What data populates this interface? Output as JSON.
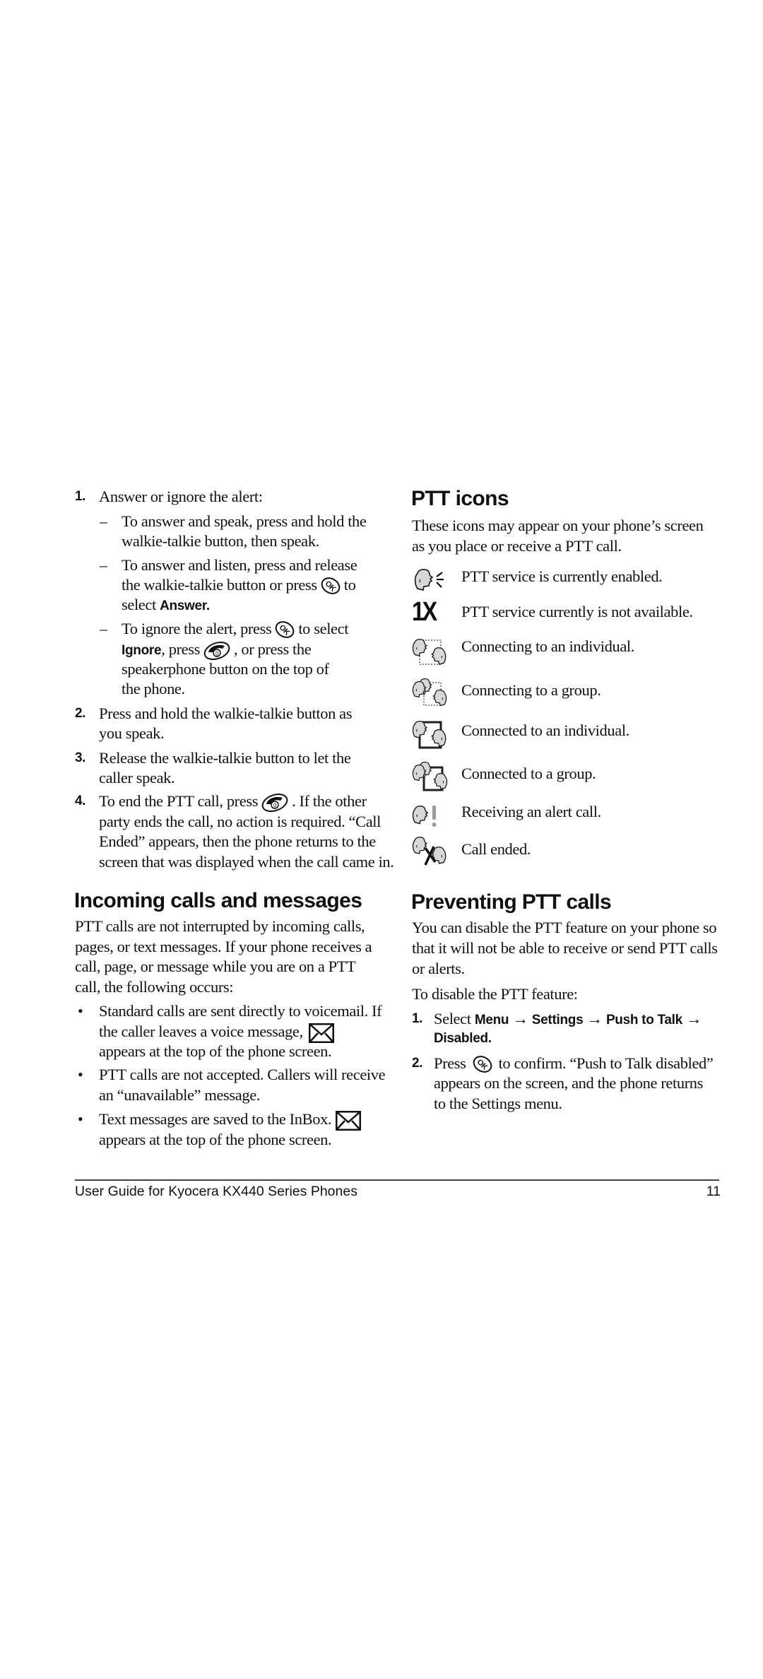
{
  "left": {
    "step1": {
      "num": "1.",
      "text": "Answer or ignore the alert:",
      "sub": [
        {
          "dash": "–",
          "lines": [
            "To answer and speak, press and hold the",
            "walkie-talkie button, then speak."
          ]
        },
        {
          "dash": "–",
          "line1": "To answer and listen, press and release",
          "line2_pre": "the walkie-talkie button or press",
          "line2_post": "to",
          "line3_pre": "select",
          "line3_bold": "Answer."
        },
        {
          "dash": "–",
          "line1_pre": "To ignore the alert, press",
          "line1_post": "to select",
          "line2_bold": "Ignore",
          "line2_mid": ", press",
          "line2_post": ", or press the",
          "line3": "speakerphone button on the top of",
          "line4": "the phone."
        }
      ]
    },
    "step2": {
      "num": "2.",
      "lines": [
        "Press and hold the walkie-talkie button as",
        "you speak."
      ]
    },
    "step3": {
      "num": "3.",
      "lines": [
        "Release the walkie-talkie button to let the",
        "caller speak."
      ]
    },
    "step4": {
      "num": "4.",
      "line1_pre": "To end the PTT call, press",
      "line1_post": ". If the other",
      "lines": [
        "party ends the call, no action is required. “Call",
        "Ended” appears, then the phone returns to the",
        "screen that was displayed when the call came in."
      ]
    },
    "incoming": {
      "heading": "Incoming calls and messages",
      "para": [
        "PTT calls are not interrupted by incoming calls,",
        "pages, or text messages. If your phone receives a",
        "call, page, or message while you are on a PTT",
        "call, the following occurs:"
      ],
      "bullets": [
        {
          "line1": "Standard calls are sent directly to voicemail. If",
          "line2": "the caller leaves a voice message,",
          "line3": "appears at the top of the phone screen."
        },
        {
          "line1": "PTT calls are not accepted. Callers will receive",
          "line2": "an “unavailable” message."
        },
        {
          "line1": "Text messages are saved to the InBox.",
          "line2": "appears at the top of the phone screen."
        }
      ],
      "bullet_char": "•"
    }
  },
  "right": {
    "ptt_icons": {
      "heading": "PTT icons",
      "intro": [
        "These icons may appear on your phone’s screen",
        "as you place or receive a PTT call."
      ],
      "items": [
        {
          "icon": "ptt-enabled-icon",
          "text": "PTT service is currently enabled."
        },
        {
          "icon": "1x-icon",
          "glyph": "1X",
          "text": "PTT service currently is not available."
        },
        {
          "icon": "connecting-individual-icon",
          "text": "Connecting to an individual."
        },
        {
          "icon": "connecting-group-icon",
          "text": "Connecting to a group."
        },
        {
          "icon": "connected-individual-icon",
          "text": "Connected to an individual."
        },
        {
          "icon": "connected-group-icon",
          "text": "Connected to a group."
        },
        {
          "icon": "alert-call-icon",
          "text": "Receiving an alert call."
        },
        {
          "icon": "call-ended-icon",
          "text": "Call ended."
        }
      ]
    },
    "preventing": {
      "heading": "Preventing PTT calls",
      "para": [
        "You can disable the PTT feature on your phone so",
        "that it will not be able to receive or send PTT calls",
        "or alerts."
      ],
      "lead": "To disable the PTT feature:",
      "step1": {
        "num": "1.",
        "pre": "Select",
        "path": [
          "Menu",
          "Settings",
          "Push to Talk"
        ],
        "arrow": "→",
        "last": "Disabled."
      },
      "step2": {
        "num": "2.",
        "pre": "Press",
        "post": "to confirm. “Push to Talk disabled”",
        "lines": [
          "appears on the screen, and the phone returns",
          "to the Settings menu."
        ]
      }
    }
  },
  "footer": {
    "title": "User Guide for Kyocera KX440 Series Phones",
    "page": "11"
  },
  "keys": {
    "ok": "OK",
    "end": "0"
  }
}
